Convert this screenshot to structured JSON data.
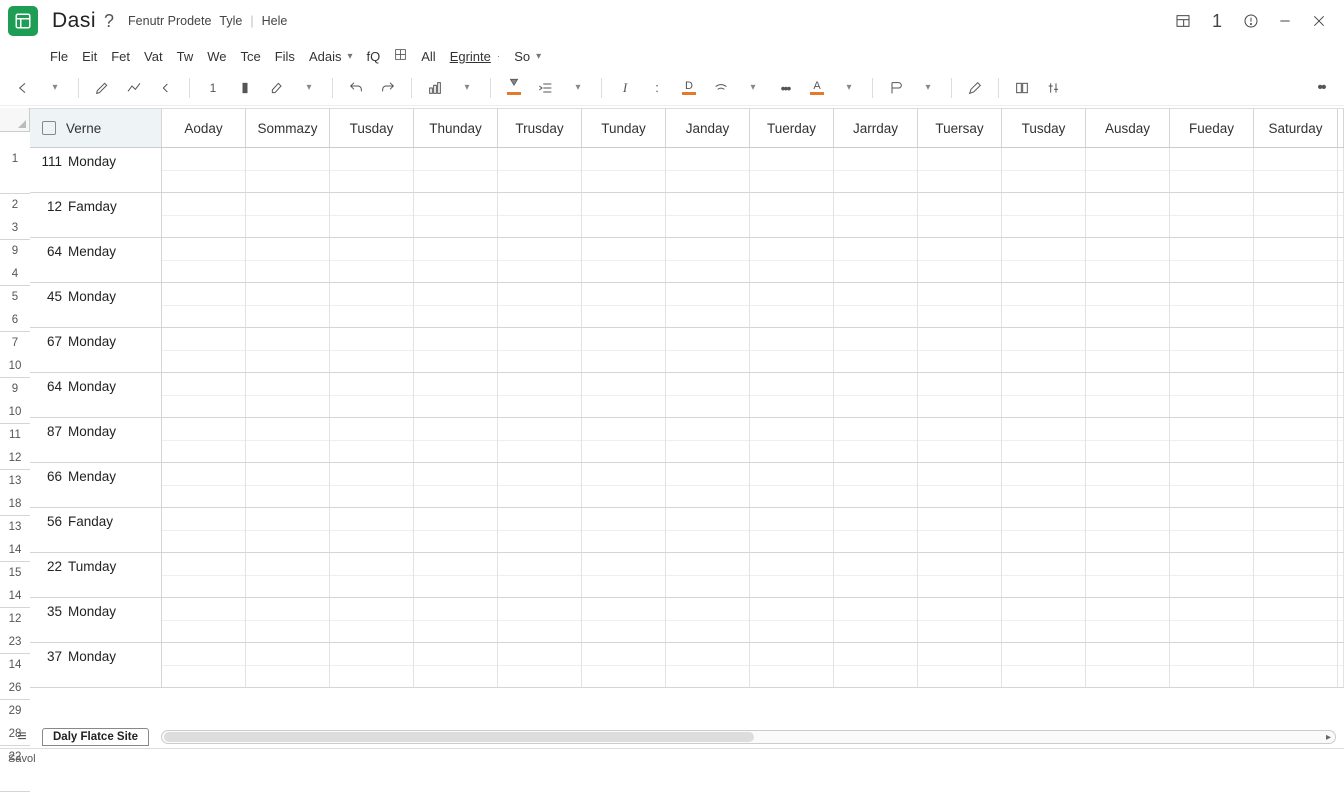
{
  "title": "Dasi",
  "meta_links": [
    "Fenutr Prodete",
    "Tyle",
    "Hele"
  ],
  "menu": [
    "Fle",
    "Eit",
    "Fet",
    "Vat",
    "Tw",
    "We",
    "Tce",
    "Fils",
    "Adais",
    "fQ",
    "All",
    "Egrinte",
    "So"
  ],
  "window_num": "1",
  "header": {
    "first": "Verne",
    "cols": [
      "Aoday",
      "Sommazy",
      "Tusday",
      "Thunday",
      "Trusday",
      "Tunday",
      "Janday",
      "Tuerday",
      "Jarrday",
      "Tuersay",
      "Tusday",
      "Ausday",
      "Fueday",
      "Saturday"
    ]
  },
  "row_heads": [
    [
      "1",
      ""
    ],
    [
      "2",
      "3"
    ],
    [
      "9",
      "4"
    ],
    [
      "5",
      "6"
    ],
    [
      "7",
      "10"
    ],
    [
      "9",
      "10"
    ],
    [
      "11",
      "12"
    ],
    [
      "13",
      "18"
    ],
    [
      "13",
      "14"
    ],
    [
      "15",
      "14"
    ],
    [
      "12",
      "23"
    ],
    [
      "14",
      "26"
    ],
    [
      "29",
      "28"
    ],
    [
      "22",
      ""
    ]
  ],
  "rows": [
    {
      "num": "111",
      "label": "Monday"
    },
    {
      "num": "12",
      "label": "Famday"
    },
    {
      "num": "64",
      "label": "Menday"
    },
    {
      "num": "45",
      "label": "Monday"
    },
    {
      "num": "67",
      "label": "Monday"
    },
    {
      "num": "64",
      "label": "Monday"
    },
    {
      "num": "87",
      "label": "Monday"
    },
    {
      "num": "66",
      "label": "Menday"
    },
    {
      "num": "56",
      "label": "Fanday"
    },
    {
      "num": "22",
      "label": "Tumday"
    },
    {
      "num": "35",
      "label": "Monday"
    },
    {
      "num": "37",
      "label": "Monday"
    }
  ],
  "tab_name": "Daly Flatce Site",
  "status": "Savol"
}
